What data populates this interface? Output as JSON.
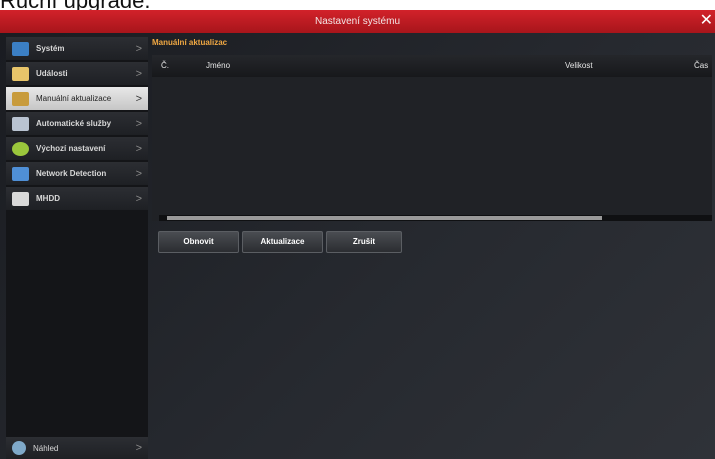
{
  "caption": "Ruční upgrade.",
  "window": {
    "title": "Nastavení systému",
    "close_glyph": "✕"
  },
  "sidebar": {
    "items": [
      {
        "label": "Systém",
        "icon": "monitor-icon",
        "color": "#3b7fc4"
      },
      {
        "label": "Události",
        "icon": "calendar-icon",
        "color": "#e8c56a"
      },
      {
        "label": "Manuální aktualizace",
        "icon": "upgrade-icon",
        "color": "#c89b3c"
      },
      {
        "label": "Automatické služby",
        "icon": "tools-icon",
        "color": "#b9c3d1"
      },
      {
        "label": "Výchozí nastavení",
        "icon": "reset-icon",
        "color": "#9bc73c"
      },
      {
        "label": "Network Detection",
        "icon": "network-icon",
        "color": "#4f8fd6"
      },
      {
        "label": "MHDD",
        "icon": "disk-icon",
        "color": "#d9d9d9"
      }
    ],
    "chevron": ">",
    "preview_label": "Náhled"
  },
  "content": {
    "header": "Manuální aktualizac",
    "columns": {
      "num": "Č.",
      "name": "Jméno",
      "size": "Velikost",
      "time": "Čas"
    },
    "rows": [],
    "buttons": {
      "refresh": "Obnovit",
      "upgrade": "Aktualizace",
      "cancel": "Zrušit"
    }
  }
}
